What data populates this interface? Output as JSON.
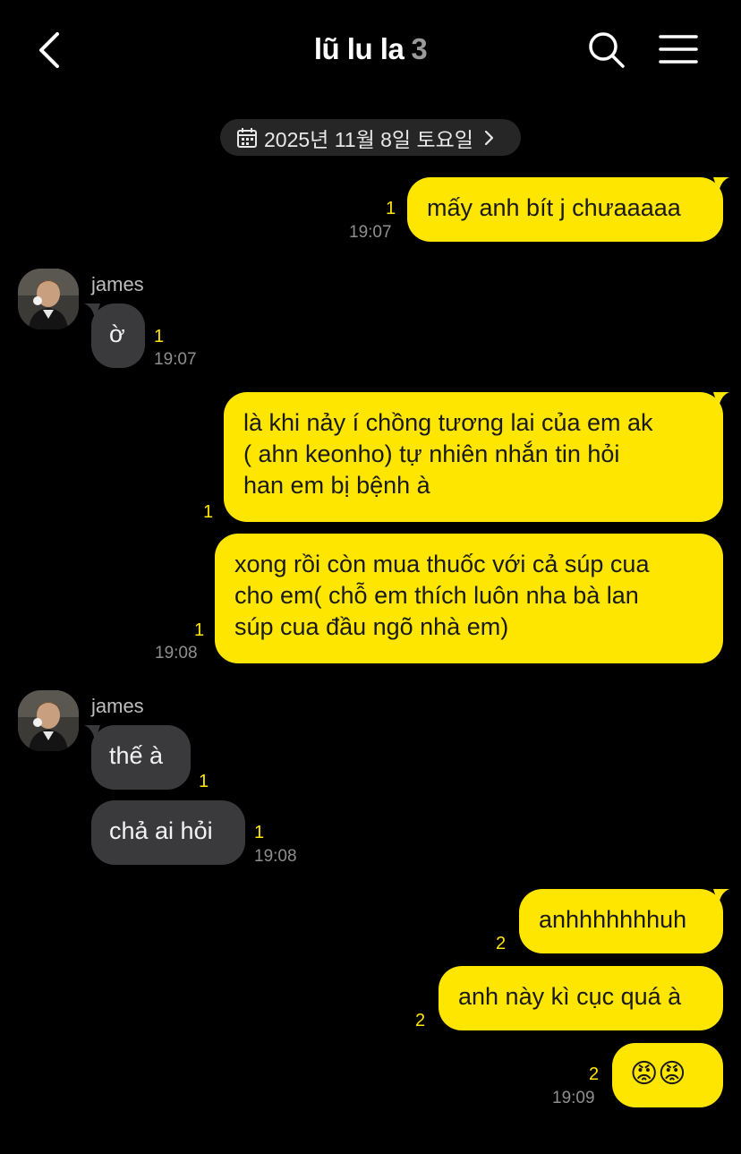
{
  "header": {
    "title": "lũ lu la",
    "member_count": "3",
    "back_icon": "chevron-left-icon",
    "search_icon": "search-icon",
    "menu_icon": "hamburger-menu-icon"
  },
  "date_divider": {
    "label": "2025년 11월 8일 토요일",
    "icon": "calendar-icon"
  },
  "colors": {
    "background": "#000000",
    "my_bubble": "#ffe600",
    "their_bubble": "#3a3a3c",
    "unread": "#ffe600",
    "time": "#8e8e8e"
  },
  "messages": [
    {
      "from": "me",
      "text": "mấy anh bít j chưaaaaa",
      "unread": "1",
      "time": "19:07"
    },
    {
      "sender": "james",
      "from": "james",
      "text": "ờ",
      "unread": "1",
      "time": "19:07"
    },
    {
      "from": "me",
      "lines": [
        "là khi nảy í chồng tương lai của em ak",
        "( ahn keonho) tự nhiên nhắn tin hỏi",
        "han em bị bệnh à"
      ],
      "unread": "1"
    },
    {
      "from": "me",
      "lines": [
        "xong rồi còn mua thuốc với cả súp cua",
        "cho em( chỗ em thích luôn nha bà lan",
        "súp cua đầu ngõ nhà em)"
      ],
      "unread": "1",
      "time": "19:08"
    },
    {
      "sender": "james",
      "from": "james",
      "text": "thế à",
      "unread": "1"
    },
    {
      "from": "james",
      "text": "chả ai hỏi",
      "unread": "1",
      "time": "19:08"
    },
    {
      "from": "me",
      "text": "anhhhhhhhuh",
      "unread": "2"
    },
    {
      "from": "me",
      "text": "anh này kì cục quá à",
      "unread": "2"
    },
    {
      "from": "me",
      "text": "😡😡",
      "unread": "2",
      "time": "19:09"
    }
  ]
}
